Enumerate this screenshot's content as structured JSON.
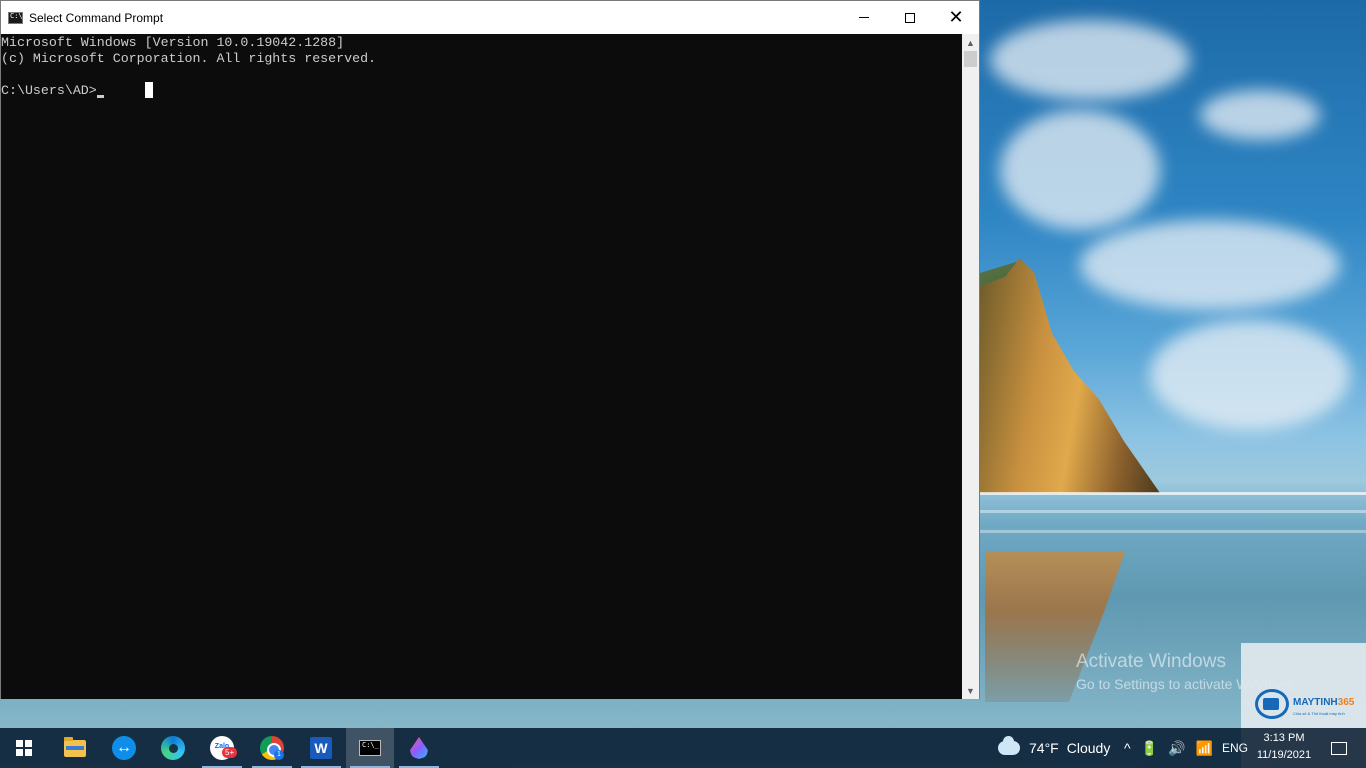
{
  "window": {
    "title": "Select Command Prompt",
    "icon": "cmd-icon",
    "controls": {
      "minimize": "minimize-icon",
      "maximize": "maximize-icon",
      "close": "close-icon"
    }
  },
  "console": {
    "lines": [
      "Microsoft Windows [Version 10.0.19042.1288]",
      "(c) Microsoft Corporation. All rights reserved.",
      "C:\\Users\\AD>"
    ],
    "background": "#0c0c0c",
    "foreground": "#cccccc"
  },
  "desktop": {
    "watermark_title": "Activate Windows",
    "watermark_subtitle": "Go to Settings to activate Windows.",
    "logo_text_primary": "MAYTINH",
    "logo_text_accent": "365",
    "logo_tagline": "Chia sẻ & Thủ thuật máy tính"
  },
  "taskbar": {
    "apps": [
      {
        "name": "start",
        "icon": "windows-icon"
      },
      {
        "name": "file-explorer",
        "icon": "folder-icon"
      },
      {
        "name": "teamviewer",
        "icon": "teamviewer-icon"
      },
      {
        "name": "edge",
        "icon": "edge-icon"
      },
      {
        "name": "zalo",
        "icon": "zalo-icon",
        "badge": "5+"
      },
      {
        "name": "chrome",
        "icon": "chrome-icon",
        "badge": "1"
      },
      {
        "name": "word",
        "icon": "word-icon",
        "glyph": "W"
      },
      {
        "name": "command-prompt",
        "icon": "cmd-icon",
        "glyph": "C:\\_"
      },
      {
        "name": "paint",
        "icon": "drop-icon"
      }
    ],
    "weather": {
      "temperature": "74°F",
      "condition": "Cloudy"
    },
    "tray": {
      "chevron": "^",
      "battery": "🔋",
      "volume": "🔊",
      "wifi": "📶",
      "language": "ENG"
    },
    "clock": {
      "time": "3:13 PM",
      "date": "11/19/2021"
    },
    "accent": "#8fb7de"
  }
}
